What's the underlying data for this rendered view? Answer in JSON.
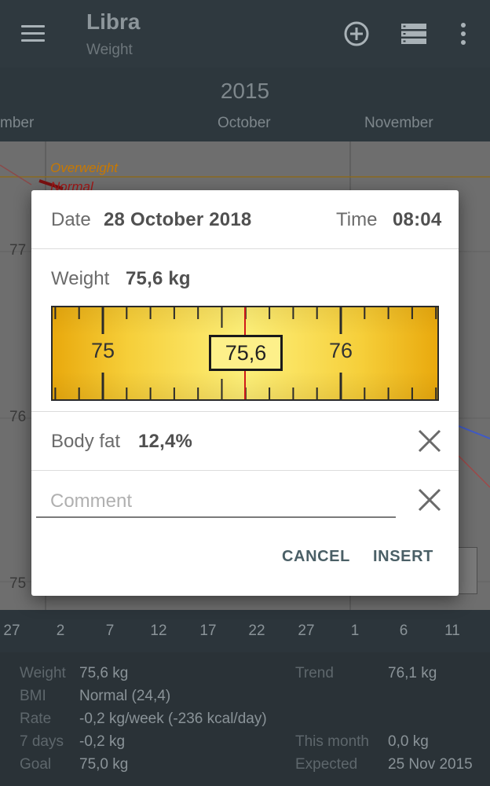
{
  "app_bar": {
    "title": "Libra",
    "subtitle": "Weight"
  },
  "chart": {
    "year": "2015",
    "months": [
      "mber",
      "October",
      "November"
    ],
    "zones": {
      "overweight": "Overweight",
      "normal": "Normal"
    },
    "y_ticks": [
      "77",
      "76",
      "75"
    ],
    "x_ticks": [
      "27",
      "2",
      "7",
      "12",
      "17",
      "22",
      "27",
      "1",
      "6",
      "11"
    ],
    "colors": {
      "overweight": "#c87800",
      "normal": "#a01818",
      "trend_line": "#3f5ac8"
    }
  },
  "dialog": {
    "date_label": "Date",
    "date_value": "28 October 2018",
    "time_label": "Time",
    "time_value": "08:04",
    "weight_label": "Weight",
    "weight_value": "75,6 kg",
    "ruler": {
      "left_mark": "75",
      "current": "75,6",
      "right_mark": "76",
      "value": 75.6
    },
    "body_fat_label": "Body fat",
    "body_fat_value": "12,4%",
    "comment_placeholder": "Comment",
    "cancel_label": "CANCEL",
    "insert_label": "INSERT"
  },
  "stats": {
    "weight_label": "Weight",
    "weight_value": "75,6 kg",
    "bmi_label": "BMI",
    "bmi_value": "Normal (24,4)",
    "rate_label": "Rate",
    "rate_value": "-0,2 kg/week (-236 kcal/day)",
    "days_label": "7 days",
    "days_value": "-0,2 kg",
    "goal_label": "Goal",
    "goal_value": "75,0 kg",
    "trend_label": "Trend",
    "trend_value": "76,1 kg",
    "month_label": "This month",
    "month_value": "0,0 kg",
    "expected_label": "Expected",
    "expected_value": "25 Nov 2015"
  }
}
